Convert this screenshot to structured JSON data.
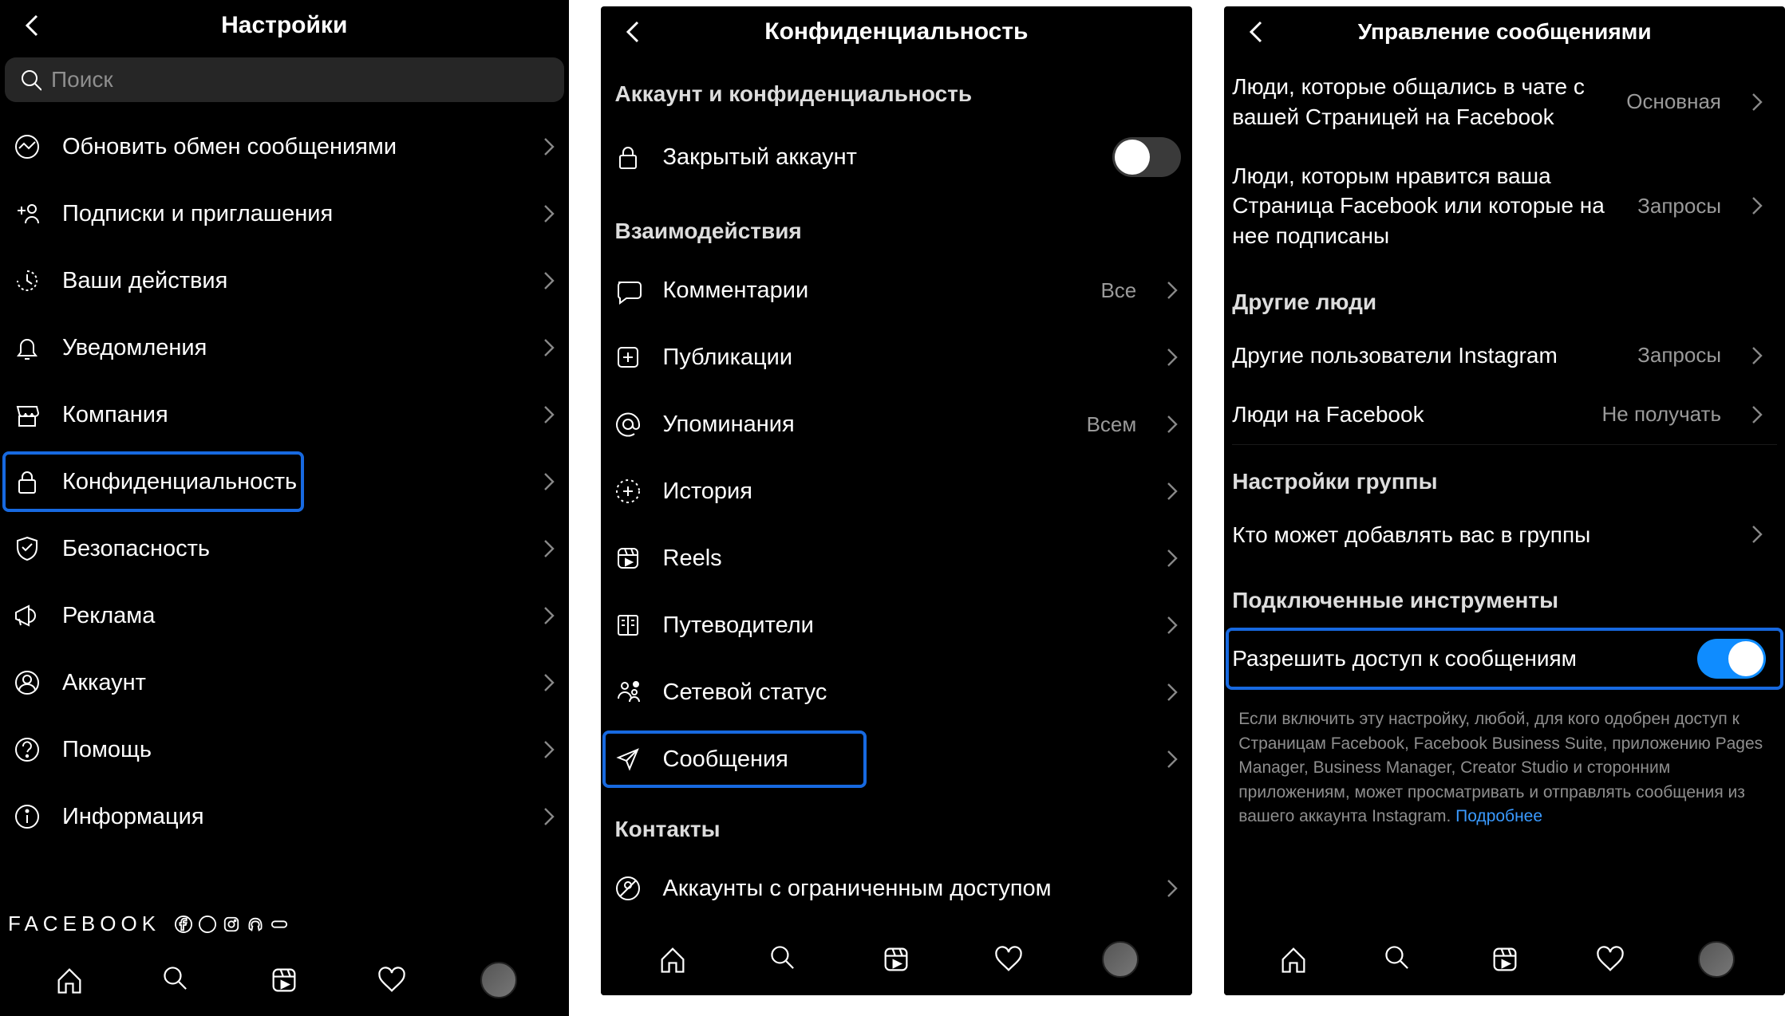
{
  "panel1": {
    "title": "Настройки",
    "search_placeholder": "Поиск",
    "items": [
      {
        "icon": "messenger",
        "label": "Обновить обмен сообщениями"
      },
      {
        "icon": "person-plus",
        "label": "Подписки и приглашения"
      },
      {
        "icon": "activity",
        "label": "Ваши действия"
      },
      {
        "icon": "bell",
        "label": "Уведомления"
      },
      {
        "icon": "store",
        "label": "Компания"
      },
      {
        "icon": "lock",
        "label": "Конфиденциальность",
        "highlight": true
      },
      {
        "icon": "shield",
        "label": "Безопасность"
      },
      {
        "icon": "megaphone",
        "label": "Реклама"
      },
      {
        "icon": "account",
        "label": "Аккаунт"
      },
      {
        "icon": "help",
        "label": "Помощь"
      },
      {
        "icon": "info",
        "label": "Информация"
      }
    ],
    "brand": "FACEBOOK"
  },
  "panel2": {
    "title": "Конфиденциальность",
    "section1": "Аккаунт и конфиденциальность",
    "private_label": "Закрытый аккаунт",
    "private_on": false,
    "section2": "Взаимодействия",
    "items": [
      {
        "icon": "comment",
        "label": "Комментарии",
        "value": "Все"
      },
      {
        "icon": "post",
        "label": "Публикации"
      },
      {
        "icon": "mention",
        "label": "Упоминания",
        "value": "Всем"
      },
      {
        "icon": "story",
        "label": "История"
      },
      {
        "icon": "reels",
        "label": "Reels"
      },
      {
        "icon": "guides",
        "label": "Путеводители"
      },
      {
        "icon": "status",
        "label": "Сетевой статус"
      },
      {
        "icon": "send",
        "label": "Сообщения",
        "highlight": true
      }
    ],
    "section3": "Контакты",
    "contacts_item": "Аккаунты с ограниченным доступом"
  },
  "panel3": {
    "title": "Управление сообщениями",
    "items_top": [
      {
        "label": "Люди, которые общались в чате с вашей Страницей на Facebook",
        "value": "Основная"
      },
      {
        "label": "Люди, которым нравится ваша Страница Facebook или которые на нее подписаны",
        "value": "Запросы"
      }
    ],
    "section_other": "Другие люди",
    "items_other": [
      {
        "label": "Другие пользователи Instagram",
        "value": "Запросы"
      },
      {
        "label": "Люди на Facebook",
        "value": "Не получать"
      }
    ],
    "section_group": "Настройки группы",
    "group_item": "Кто может добавлять вас в группы",
    "section_tools": "Подключенные инструменты",
    "allow_label": "Разрешить доступ к сообщениям",
    "allow_on": true,
    "footnote": "Если включить эту настройку, любой, для кого одобрен доступ к Страницам Facebook, Facebook Business Suite, приложению Pages Manager, Business Manager, Creator Studio и сторонним приложениям, может просматривать и отправлять сообщения из вашего аккаунта Instagram.",
    "footnote_link": "Подробнее"
  }
}
